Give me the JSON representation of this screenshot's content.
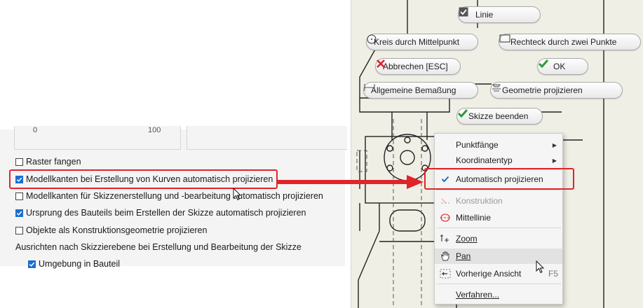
{
  "settings": {
    "slider_tick_0": "0",
    "slider_tick_100": "100",
    "snap_grid": "Raster fangen",
    "project_edges_create": "Modellkanten bei Erstellung von Kurven automatisch projizieren",
    "project_edges_edit": "Modellkanten für Skizzenerstellung und -bearbeitung automatisch projizieren",
    "project_origin": "Ursprung des Bauteils beim Erstellen der Skizze automatisch projizieren",
    "construction_geometry": "Objekte als Konstruktionsgeometrie projizieren",
    "align_heading": "Ausrichten nach Skizzierebene bei Erstellung und Bearbeitung der Skizze",
    "surroundings": "Umgebung in Bauteil"
  },
  "marking_menu": {
    "line": "Linie",
    "circle_center": "Kreis durch Mittelpunkt",
    "rectangle": "Rechteck durch zwei Punkte",
    "cancel": "Abbrechen [ESC]",
    "ok": "OK",
    "dimension": "Allgemeine Bemaßung",
    "project_geometry": "Geometrie projizieren",
    "finish_sketch": "Skizze beenden"
  },
  "context_menu": {
    "snaps": "Punktfänge",
    "coord_type": "Koordinatentyp",
    "auto_project": "Automatisch projizieren",
    "construction": "Konstruktion",
    "centerline": "Mittellinie",
    "zoom": "Zoom",
    "pan": "Pan",
    "previous_view": "Vorherige Ansicht",
    "previous_view_shortcut": "F5",
    "procedures": "Verfahren..."
  },
  "colors": {
    "accent": "#1b6fd0",
    "highlight": "#e0242a",
    "ok_green": "#2a9a3a",
    "cancel_red": "#d8232a"
  }
}
